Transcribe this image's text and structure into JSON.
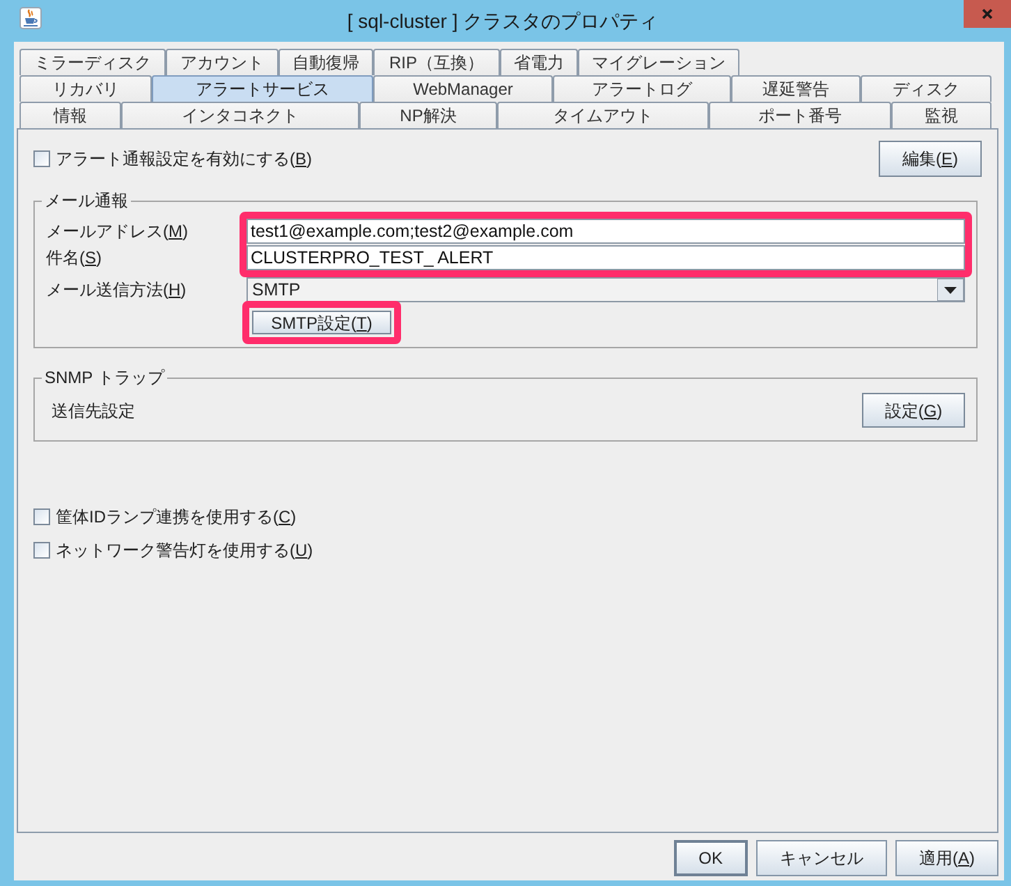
{
  "window": {
    "title": "[ sql-cluster ] クラスタのプロパティ"
  },
  "tab_rows": [
    [
      {
        "label": "ミラーディスク",
        "selected": false
      },
      {
        "label": "アカウント",
        "selected": false
      },
      {
        "label": "自動復帰",
        "selected": false
      },
      {
        "label": "RIP（互換）",
        "selected": false
      },
      {
        "label": "省電力",
        "selected": false
      },
      {
        "label": "マイグレーション",
        "selected": false
      }
    ],
    [
      {
        "label": "リカバリ",
        "selected": false
      },
      {
        "label": "アラートサービス",
        "selected": true
      },
      {
        "label": "WebManager",
        "selected": false
      },
      {
        "label": "アラートログ",
        "selected": false
      },
      {
        "label": "遅延警告",
        "selected": false
      },
      {
        "label": "ディスク",
        "selected": false
      }
    ],
    [
      {
        "label": "情報",
        "selected": false
      },
      {
        "label": "インタコネクト",
        "selected": false
      },
      {
        "label": "NP解決",
        "selected": false
      },
      {
        "label": "タイムアウト",
        "selected": false
      },
      {
        "label": "ポート番号",
        "selected": false
      },
      {
        "label": "監視",
        "selected": false
      }
    ]
  ],
  "alert": {
    "enable": {
      "label": "アラート通報設定を有効にする(B)",
      "checked": false
    },
    "edit_button": "編集(E)"
  },
  "mail_notification": {
    "title": "メール通報",
    "fields": [
      {
        "kind": "text",
        "label": "メールアドレス(M)",
        "value": "test1@example.com;test2@example.com",
        "highlighted": true
      },
      {
        "kind": "text",
        "label": "件名(S)",
        "value": "CLUSTERPRO_TEST_ ALERT",
        "highlighted": true
      },
      {
        "kind": "select",
        "label": "メール送信方法(H)",
        "value": "SMTP",
        "highlighted": false
      }
    ],
    "smtp_button": {
      "label": "SMTP設定(T)",
      "highlighted": true
    }
  },
  "snmp_trap": {
    "title": "SNMP トラップ",
    "label": "送信先設定",
    "button": "設定(G)"
  },
  "options": [
    {
      "label": "筐体IDランプ連携を使用する(C)",
      "checked": false
    },
    {
      "label": "ネットワーク警告灯を使用する(U)",
      "checked": false
    }
  ],
  "buttons": [
    {
      "label": "OK",
      "default": true
    },
    {
      "label": "キャンセル",
      "default": false
    },
    {
      "label": "適用(A)",
      "default": false
    }
  ]
}
